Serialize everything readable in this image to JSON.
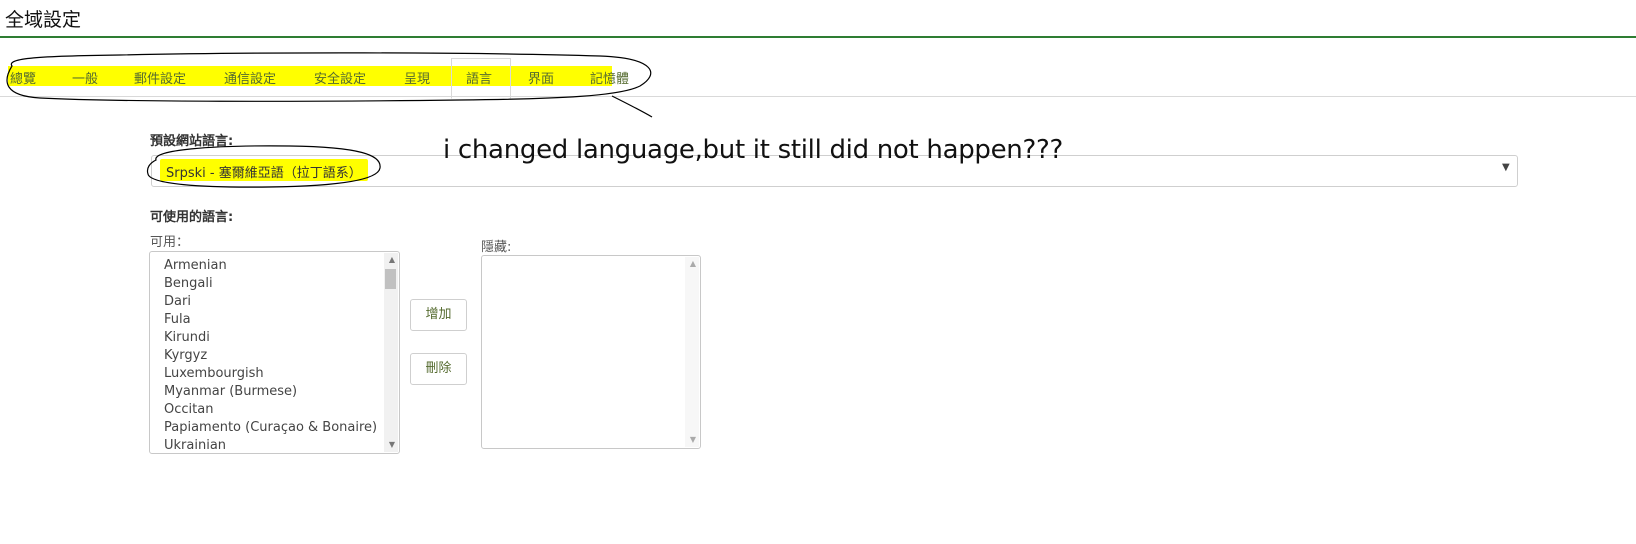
{
  "header": {
    "title": "全域設定"
  },
  "tabs": [
    {
      "label": "總覽"
    },
    {
      "label": "一般"
    },
    {
      "label": "郵件設定"
    },
    {
      "label": "通信設定"
    },
    {
      "label": "安全設定"
    },
    {
      "label": "呈現"
    },
    {
      "label": "語言"
    },
    {
      "label": "界面"
    },
    {
      "label": "記憶體"
    }
  ],
  "active_tab": "語言",
  "default_language": {
    "label": "預設網站語言:",
    "value": "Srpski - 塞爾維亞語（拉丁語系）"
  },
  "annotation": "i changed language,but it still did not happen???",
  "available_languages": {
    "label": "可使用的語言:",
    "available_label": "可用：",
    "hidden_label": "隱藏:",
    "available_items": [
      "Armenian",
      "Bengali",
      "Dari",
      "Fula",
      "Kirundi",
      "Kyrgyz",
      "Luxembourgish",
      "Myanmar (Burmese)",
      "Occitan",
      "Papiamento (Curaçao & Bonaire)",
      "Ukrainian"
    ],
    "hidden_items": []
  },
  "buttons": {
    "add": "增加",
    "remove": "刪除"
  },
  "colors": {
    "highlight": "#ffff00",
    "header_rule": "#2e7d32",
    "tab_text": "#556b2f"
  }
}
